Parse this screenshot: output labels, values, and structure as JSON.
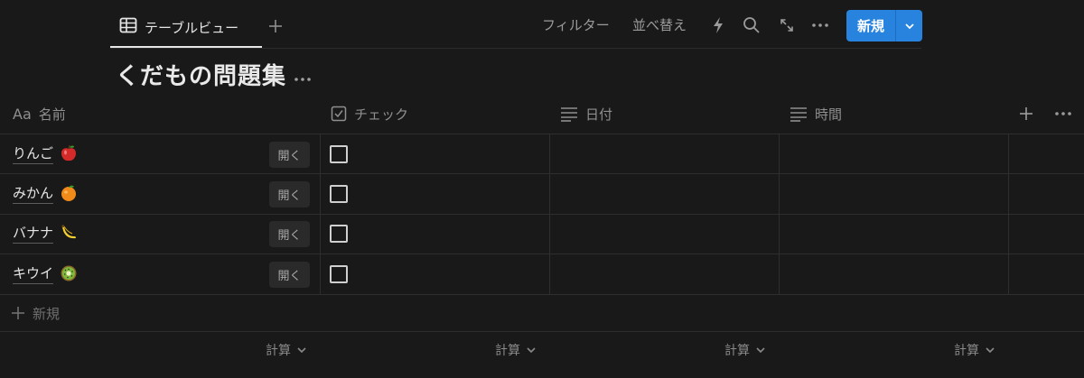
{
  "topbar": {
    "view_tab_label": "テーブルビュー",
    "filter_label": "フィルター",
    "sort_label": "並べ替え",
    "new_button_label": "新規"
  },
  "page": {
    "title": "くだもの問題集"
  },
  "table": {
    "columns": [
      {
        "label": "名前",
        "type_icon": "Aa"
      },
      {
        "label": "チェック",
        "type_icon": "checkbox-icon"
      },
      {
        "label": "日付",
        "type_icon": "text-lines-icon"
      },
      {
        "label": "時間",
        "type_icon": "text-lines-icon"
      }
    ],
    "rows": [
      {
        "name": "りんご",
        "emoji": "apple",
        "open_label": "開く",
        "checked": false
      },
      {
        "name": "みかん",
        "emoji": "tangerine",
        "open_label": "開く",
        "checked": false
      },
      {
        "name": "バナナ",
        "emoji": "banana",
        "open_label": "開く",
        "checked": false
      },
      {
        "name": "キウイ",
        "emoji": "kiwi",
        "open_label": "開く",
        "checked": false
      }
    ],
    "add_row_label": "新規",
    "calc_label": "計算"
  },
  "colors": {
    "background": "#191919",
    "accent": "#2783de"
  }
}
